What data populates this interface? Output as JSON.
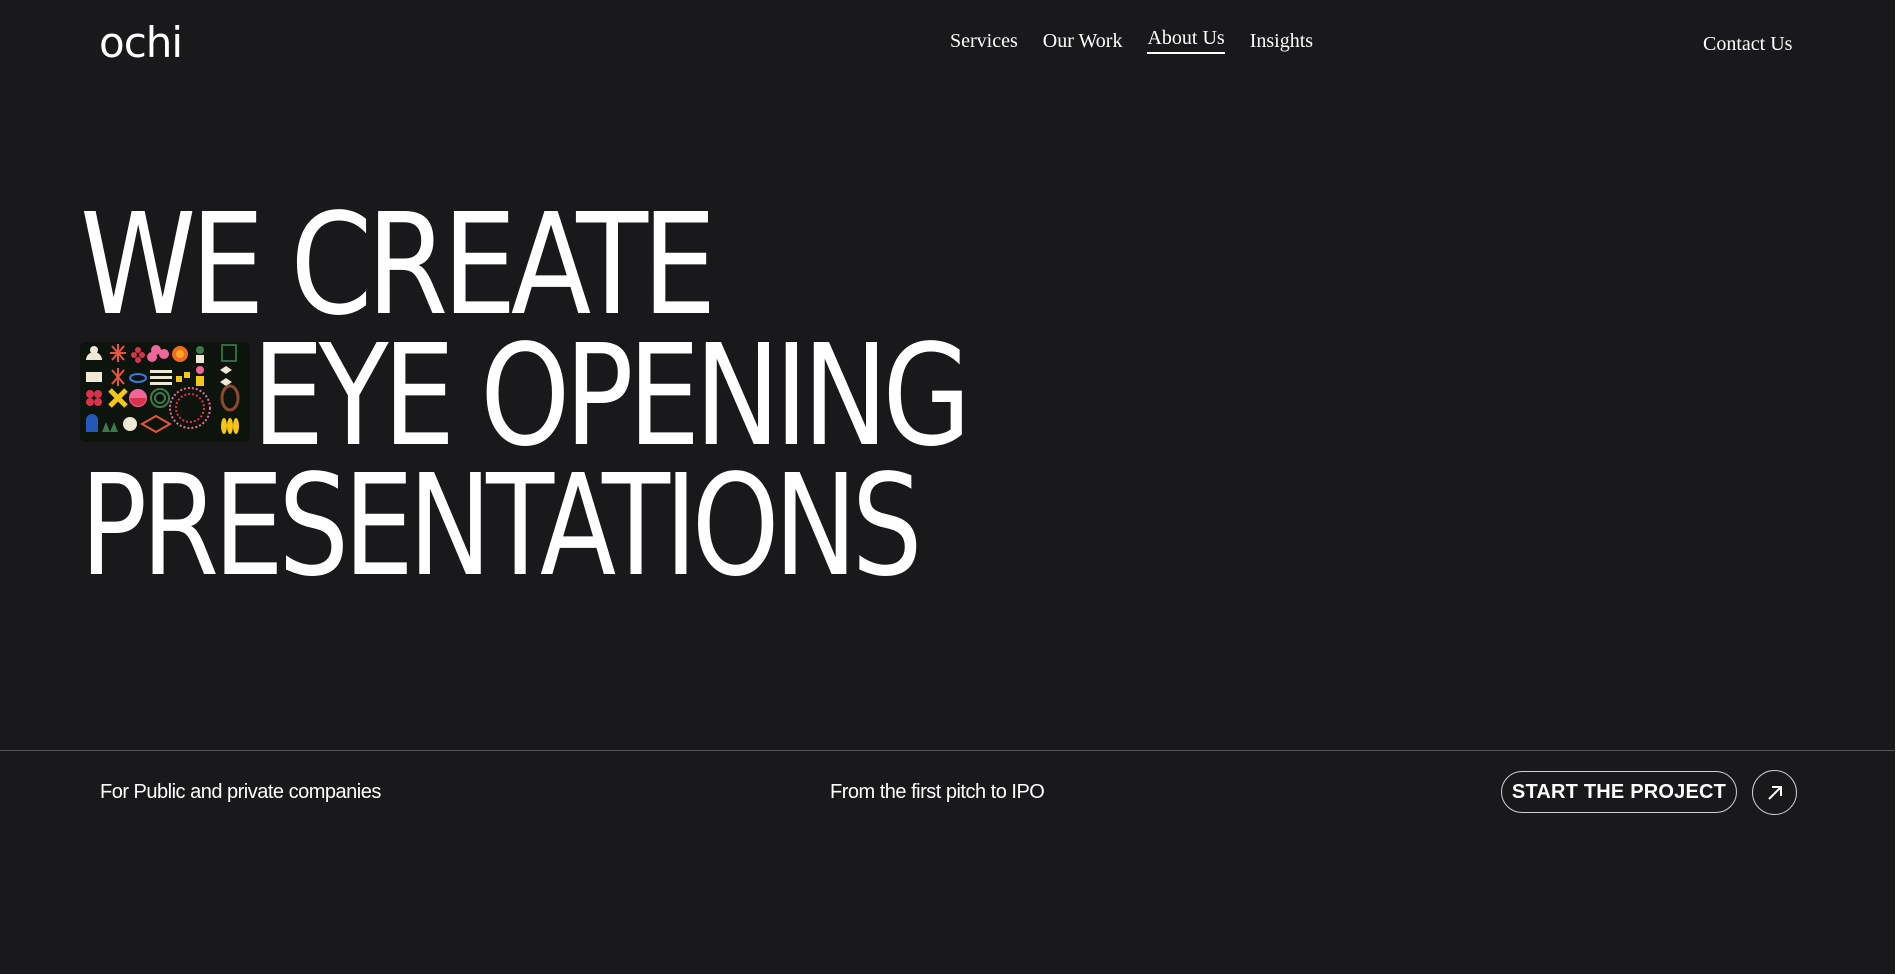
{
  "header": {
    "logo": "ochi",
    "nav": [
      {
        "label": "Services",
        "active": false
      },
      {
        "label": "Our Work",
        "active": false
      },
      {
        "label": "About Us",
        "active": true
      },
      {
        "label": "Insights",
        "active": false
      }
    ],
    "contact_label": "Contact Us"
  },
  "hero": {
    "line1": "WE CREATE",
    "line2": "EYE OPENING",
    "line3": "PRESENTATIONS"
  },
  "footer_strip": {
    "left_text": "For Public and private companies",
    "middle_text": "From the first pitch to IPO",
    "cta_label": "START THE PROJECT",
    "cta_icon": "arrow-up-right-icon"
  },
  "colors": {
    "background": "#19191b",
    "text": "#ffffff",
    "divider": "#55555a"
  }
}
